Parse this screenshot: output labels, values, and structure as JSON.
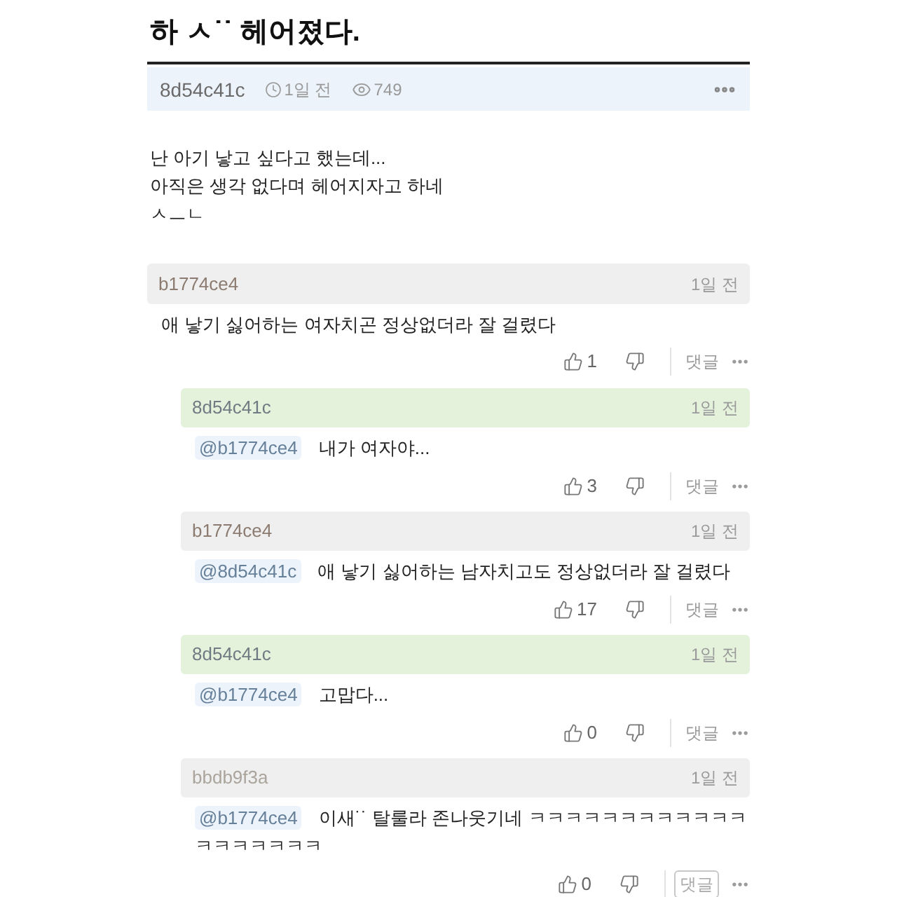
{
  "post": {
    "title": "하 ㅅ˙˙ 헤어졌다.",
    "author": "8d54c41c",
    "time": "1일 전",
    "views": "749",
    "body": [
      "난 아기 낳고 싶다고 했는데...",
      "아직은 생각 없다며 헤어지자고 하네",
      "ㅅㅡㄴ"
    ]
  },
  "comments": [
    {
      "author": "b1774ce4",
      "color": "#8c7b70",
      "by_poster": false,
      "time": "1일 전",
      "text": "애 낳기 싫어하는 여자치곤 정상없더라 잘 걸렸다",
      "likes": "1",
      "reply_label": "댓글",
      "reply_focused": false,
      "children": [
        {
          "author": "8d54c41c",
          "color": "#6f7b82",
          "by_poster": true,
          "time": "1일 전",
          "mention": "@b1774ce4",
          "text": "내가 여자야...",
          "likes": "3",
          "reply_label": "댓글",
          "reply_focused": false
        },
        {
          "author": "b1774ce4",
          "color": "#8c7b70",
          "by_poster": false,
          "time": "1일 전",
          "mention": "@8d54c41c",
          "text": "애 낳기 싫어하는 남자치고도 정상없더라 잘 걸렸다",
          "likes": "17",
          "reply_label": "댓글",
          "reply_focused": false
        },
        {
          "author": "8d54c41c",
          "color": "#6f7b82",
          "by_poster": true,
          "time": "1일 전",
          "mention": "@b1774ce4",
          "text": "고맙다...",
          "likes": "0",
          "reply_label": "댓글",
          "reply_focused": false
        },
        {
          "author": "bbdb9f3a",
          "color": "#aaa49c",
          "by_poster": false,
          "time": "1일 전",
          "mention": "@b1774ce4",
          "text": "이새˙˙ 탈룰라 존나웃기네 ㅋㅋㅋㅋㅋㅋㅋㅋㅋㅋㅋㅋㅋㅋㅋㅋㅋㅋㅋ",
          "likes": "0",
          "reply_label": "댓글",
          "reply_focused": true
        }
      ]
    }
  ]
}
